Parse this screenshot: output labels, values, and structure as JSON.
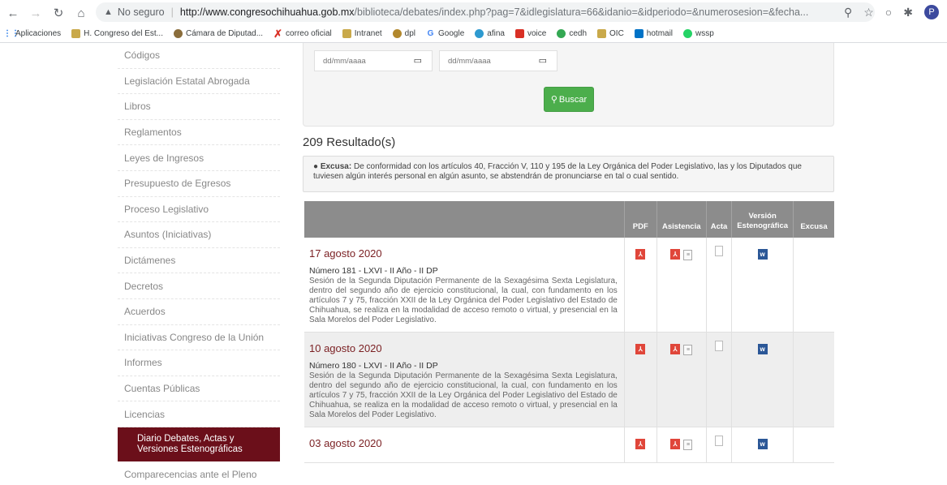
{
  "browser": {
    "security_label": "No seguro",
    "url_domain": "http://www.congresochihuahua.gob.mx",
    "url_path": "/biblioteca/debates/index.php?pag=7&idlegislatura=66&idanio=&idperiodo=&numerosesion=&fecha...",
    "profile_initial": "P",
    "bookmarks": [
      "Aplicaciones",
      "H. Congreso del Est...",
      "Cámara de Diputad...",
      "correo oficial",
      "Intranet",
      "dpl",
      "Google",
      "afina",
      "voice",
      "cedh",
      "OIC",
      "hotmail",
      "wssp"
    ]
  },
  "sidebar": {
    "items": [
      "Códigos",
      "Legislación Estatal Abrogada",
      "Libros",
      "Reglamentos",
      "Leyes de Ingresos",
      "Presupuesto de Egresos",
      "Proceso Legislativo",
      "Asuntos (Iniciativas)",
      "Dictámenes",
      "Decretos",
      "Acuerdos",
      "Iniciativas Congreso de la Unión",
      "Informes",
      "Cuentas Públicas",
      "Licencias"
    ],
    "active_line1": "Diario Debates, Actas y",
    "active_line2": "Versiones Estenográficas",
    "after_active": "Comparecencias ante el Pleno"
  },
  "search": {
    "date_from_placeholder": "dd/mm/aaaa",
    "date_to_placeholder": "dd/mm/aaaa",
    "button_label": "Buscar"
  },
  "results": {
    "count_label": "209 Resultado(s)",
    "notice_label": "Excusa:",
    "notice_text": "De conformidad con los artículos 40, Fracción V, 110 y 195 de la Ley Orgánica del Poder Legislativo, las y los Diputados que tuviesen algún interés personal en algún asunto, se abstendrán de pronunciarse en tal o cual sentido.",
    "columns": {
      "pdf": "PDF",
      "asistencia": "Asistencia",
      "acta": "Acta",
      "version_l1": "Versión",
      "version_l2": "Estenográfica",
      "excusa": "Excusa"
    },
    "rows": [
      {
        "date": "17 agosto 2020",
        "number": "Número 181 - LXVI - II Año - II DP",
        "description": "Sesión de la Segunda Diputación Permanente de la Sexagésima Sexta Legislatura, dentro del segundo año de ejercicio constitucional, la cual, con fundamento en los artículos 7 y 75, fracción XXII de la Ley Orgánica del Poder Legislativo del Estado de Chihuahua, se realiza en la modalidad de acceso remoto o virtual, y presencial en la Sala Morelos del Poder Legislativo."
      },
      {
        "date": "10 agosto 2020",
        "number": "Número 180 - LXVI - II Año - II DP",
        "description": "Sesión de la Segunda Diputación Permanente de la Sexagésima Sexta Legislatura, dentro del segundo año de ejercicio constitucional, la cual, con fundamento en los artículos 7 y 75, fracción XXII de la Ley Orgánica del Poder Legislativo del Estado de Chihuahua, se realiza en la modalidad de acceso remoto o virtual, y presencial en la Sala Morelos del Poder Legislativo."
      },
      {
        "date": "03 agosto 2020"
      }
    ]
  }
}
